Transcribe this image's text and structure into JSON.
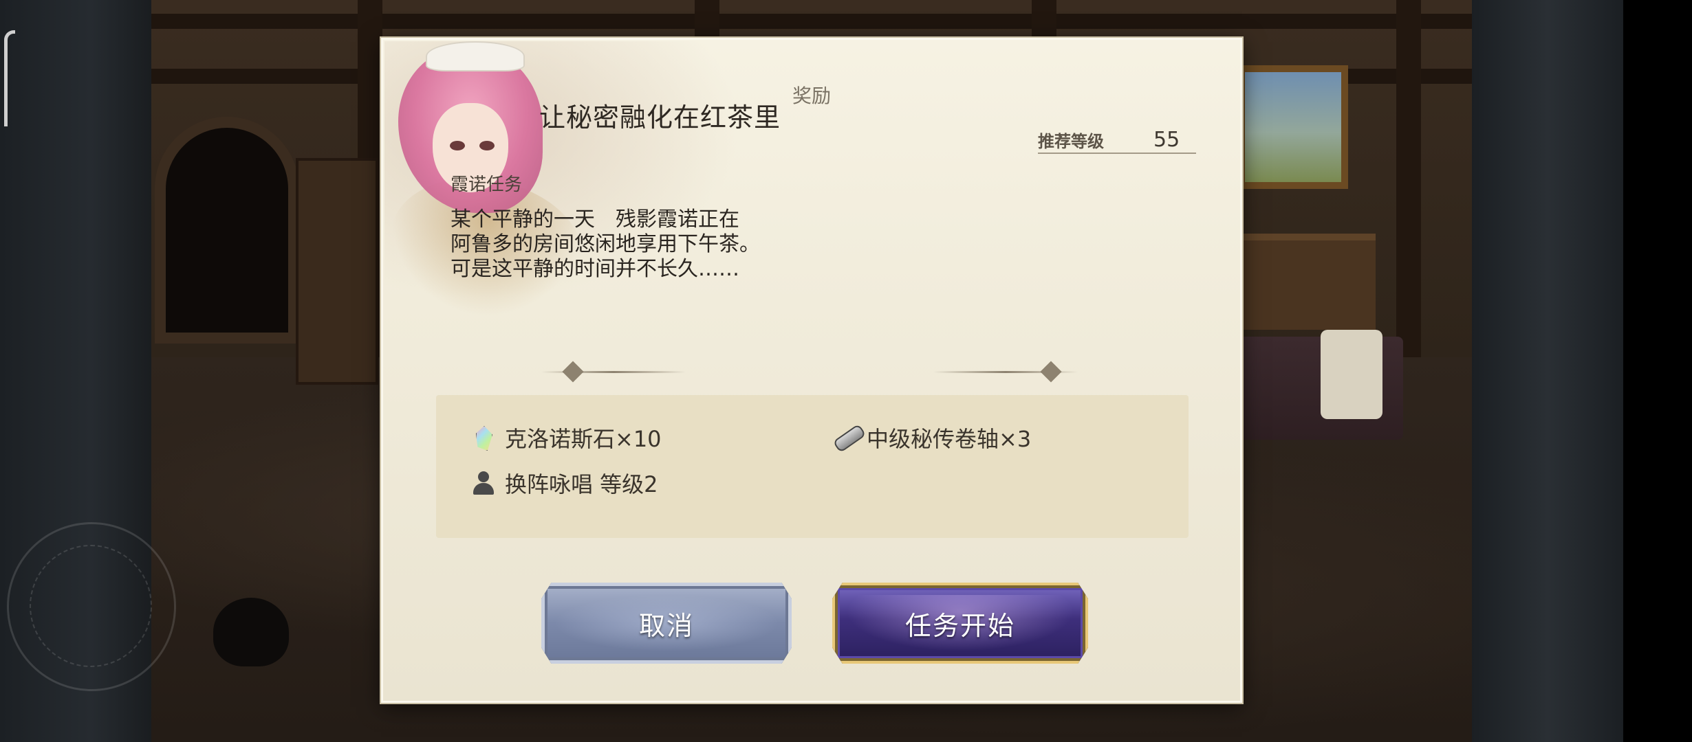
{
  "dialog": {
    "title": "让秘密融化在红茶里",
    "recommended_level": {
      "label": "推荐等级",
      "value": "55"
    },
    "mission_type": "霞诺任务",
    "description_lines": [
      "某个平静的一天　残影霞诺正在",
      "阿鲁多的房间悠闲地享用下午茶。",
      "可是这平静的时间并不长久……"
    ],
    "reward_section_label": "奖励",
    "rewards": [
      {
        "icon": "chronos-stone-icon",
        "text": "克洛诺斯石×10"
      },
      {
        "icon": "scroll-icon",
        "text": "中级秘传卷轴×3"
      },
      {
        "icon": "person-icon",
        "text": "换阵咏唱 等级2"
      }
    ],
    "buttons": {
      "cancel": "取消",
      "start": "任务开始"
    }
  },
  "colors": {
    "dialog_bg": "#f3eedf",
    "reward_box_bg": "#e8dfc4",
    "cancel_button": "#7c89aa",
    "start_button": "#3e2f7c",
    "start_button_border": "#e8c878"
  }
}
